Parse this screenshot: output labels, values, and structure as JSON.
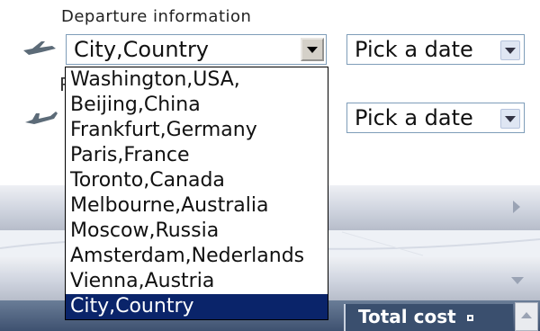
{
  "departure": {
    "section_label": "Departure information",
    "city_select": {
      "value": "City,Country"
    },
    "date_select": {
      "value": "Pick a date"
    }
  },
  "return": {
    "label_partial": "R",
    "date_select": {
      "value": "Pick a date"
    }
  },
  "dropdown": {
    "options": [
      "Washington,USA,",
      "Beijing,China",
      "Frankfurt,Germany",
      "Paris,France",
      "Toronto,Canada",
      "Melbourne,Australia",
      "Moscow,Russia",
      "Amsterdam,Nederlands",
      "Vienna,Austria",
      "City,Country"
    ],
    "selected": "City,Country"
  },
  "results": {
    "total_cost_label": "Total cost"
  },
  "icons": [
    "airplane-takeoff-icon",
    "airplane-landing-icon",
    "combo-arrow-icon",
    "expand-right-icon",
    "expand-down-icon",
    "sort-icon",
    "scroll-up-icon"
  ],
  "colors": {
    "selected_bg": "#0a246a",
    "selected_text": "#ffffff",
    "panel_dark": "#3a4f6e",
    "select_border": "#7f9db9"
  }
}
